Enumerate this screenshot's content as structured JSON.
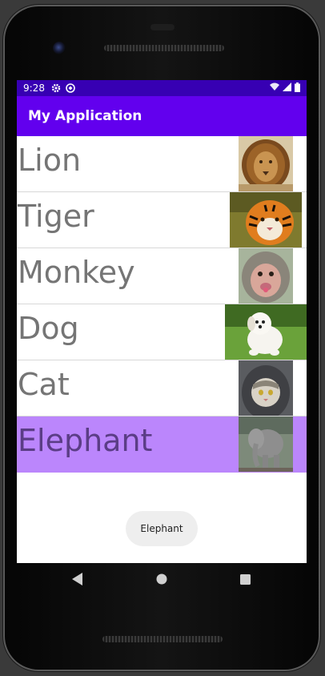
{
  "status_bar": {
    "time": "9:28"
  },
  "app_bar": {
    "title": "My Application"
  },
  "animals": [
    {
      "name": "Lion"
    },
    {
      "name": "Tiger"
    },
    {
      "name": "Monkey"
    },
    {
      "name": "Dog"
    },
    {
      "name": "Cat"
    },
    {
      "name": "Elephant"
    }
  ],
  "selected_item": "Elephant",
  "toast": {
    "text": "Elephant"
  },
  "colors": {
    "status_bar": "#3700b3",
    "app_bar": "#6200ee",
    "selected_row": "#bb86fc",
    "item_text": "#757575"
  }
}
